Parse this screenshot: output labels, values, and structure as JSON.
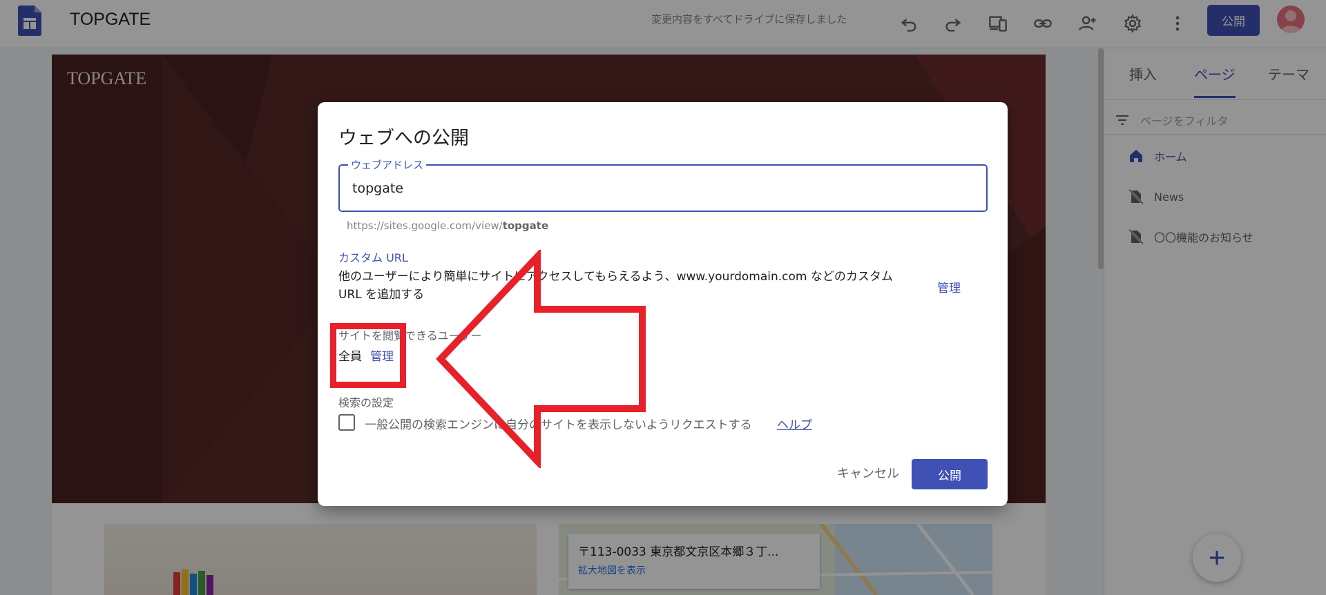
{
  "topbar": {
    "site_title": "TOPGATE",
    "saved_status": "変更内容をすべてドライブに保存しました",
    "publish_label": "公開"
  },
  "canvas": {
    "hero_title": "TOPGATE",
    "map_address": "〒113-0033 東京都文京区本郷３丁...",
    "map_link": "拡大地図を表示"
  },
  "right_panel": {
    "tabs": [
      {
        "label": "挿入"
      },
      {
        "label": "ページ"
      },
      {
        "label": "テーマ"
      }
    ],
    "active_tab": "ページ",
    "filter_placeholder": "ページをフィルタ",
    "pages": [
      {
        "label": "ホーム",
        "icon": "home-icon"
      },
      {
        "label": "News",
        "icon": "hidden-page-icon"
      },
      {
        "label": "〇〇機能のお知らせ",
        "icon": "hidden-page-icon"
      }
    ]
  },
  "dialog": {
    "title": "ウェブへの公開",
    "web_address_label": "ウェブアドレス",
    "web_address_value": "topgate",
    "url_prefix": "https://sites.google.com/view/",
    "url_suffix": "topgate",
    "custom_url_title": "カスタム URL",
    "custom_url_desc": "他のユーザーにより簡単にサイトにアクセスしてもらえるよう、www.yourdomain.com などのカスタム URL を追加する",
    "custom_url_manage": "管理",
    "viewers_title": "サイトを閲覧できるユーザー",
    "viewers_value": "全員",
    "viewers_manage": "管理",
    "search_title": "検索の設定",
    "search_checkbox_label": "一般公開の検索エンジンに自分のサイトを表示しないようリクエストする",
    "search_checkbox_checked": false,
    "help_link": "ヘルプ",
    "cancel_label": "キャンセル",
    "publish_label": "公開"
  },
  "colors": {
    "accent": "#3f51b5",
    "annotation_red": "#e8202a",
    "hero_bg": "#5b2a2a"
  }
}
